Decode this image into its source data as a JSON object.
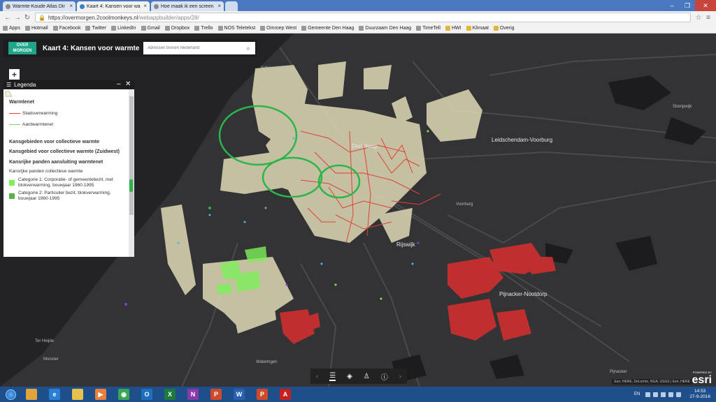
{
  "browser": {
    "tabs": [
      {
        "label": "Warmte-Koude Atlas Dir",
        "active": false
      },
      {
        "label": "Kaart 4: Kansen voor wa",
        "active": true
      },
      {
        "label": "Hoe maak ik een screen",
        "active": false
      }
    ],
    "url_host": "https://overmorgen.2coolmonkeys.nl",
    "url_path": "/webappbuilder/apps/28/",
    "bookmarks": [
      {
        "label": "Apps",
        "icon": "apps-icon"
      },
      {
        "label": "Hotmail",
        "icon": "hotmail-icon"
      },
      {
        "label": "Facebook",
        "icon": "facebook-icon"
      },
      {
        "label": "Twitter",
        "icon": "twitter-icon"
      },
      {
        "label": "LinkedIn",
        "icon": "linkedin-icon"
      },
      {
        "label": "Gmail",
        "icon": "gmail-icon"
      },
      {
        "label": "Dropbox",
        "icon": "dropbox-icon"
      },
      {
        "label": "Trello",
        "icon": "trello-icon"
      },
      {
        "label": "NOS Teletekst",
        "icon": "nos-icon"
      },
      {
        "label": "Omroep West",
        "icon": "omroep-icon"
      },
      {
        "label": "Gemeente Den Haag",
        "icon": "gemeente-icon"
      },
      {
        "label": "Duurzaam Den Haag",
        "icon": "duurzaam-icon"
      },
      {
        "label": "TimeTell",
        "icon": "timetell-icon"
      },
      {
        "label": "HWI",
        "icon": "folder-icon"
      },
      {
        "label": "Klimaat",
        "icon": "folder-icon"
      },
      {
        "label": "Overig",
        "icon": "folder-icon"
      }
    ]
  },
  "app": {
    "logo_line1": "OVER",
    "logo_line2": "MORGEN",
    "title": "Kaart 4: Kansen voor warmte",
    "search_placeholder": "Adressen binnen Nederland",
    "zoom_in": "+"
  },
  "legend": {
    "header": "Legenda",
    "sections": {
      "warmtenet_title": "Warmtenet",
      "stadsverwarming": "Stadsverwarming",
      "aardwarmtenet": "Aardwarmtenet",
      "kansgebieden_title": "Kansgebieden voor collectieve warmte",
      "kansgebied_zw_title": "Kansgebied voor collectieve warmte (Zuidwest)",
      "kansrijke_title": "Kansrijke panden aansluiting warmtenet",
      "kansrijke_sub": "Kansrijke panden collectieve warmte",
      "cat1": "Categorie 1: Corporatie- of gemeentebezit, met blokverwarming, bouwjaar 1960-1995",
      "cat2": "Categorie 2: Particulier bezit, blokverwarming, bouwjaar 1960-1995"
    },
    "colors": {
      "stadsverwarming": "#e0413a",
      "aardwarmtenet": "#7ed957",
      "kansgebied": "#efeacb",
      "cat1": "#7df05a",
      "cat2": "#5bb04a"
    }
  },
  "map_labels": {
    "den_haag": "Den Haag",
    "leidschendam": "Leidschendam-Voorburg",
    "voorburg": "Voorburg",
    "rijswijk": "Rijswijk",
    "pijnacker": "Pijnacker-Nootdorp",
    "stompwijk": "Stompwijk",
    "scheveningen": "Scheveningen",
    "ter_heijde": "Ter Heijde",
    "monster": "Monster",
    "wateringen": "Wateringen",
    "pijnacker_small": "Pijnacker"
  },
  "map_bottom": {
    "attribution": "Esri, HERE, DeLorme, NGA, USGS | Esri, HERE",
    "powered_by": "POWERED BY",
    "esri": "esri"
  },
  "taskbar": {
    "apps": [
      {
        "name": "explorer-app-icon",
        "color": "#e0a43a",
        "glyph": ""
      },
      {
        "name": "ie-app-icon",
        "color": "#2a7fd4",
        "glyph": "e"
      },
      {
        "name": "folder-app-icon",
        "color": "#e8c04c",
        "glyph": ""
      },
      {
        "name": "media-app-icon",
        "color": "#e8803a",
        "glyph": "▶"
      },
      {
        "name": "chrome-app-icon",
        "color": "#3aa655",
        "glyph": "◉"
      },
      {
        "name": "outlook-app-icon",
        "color": "#1f6fc0",
        "glyph": "O"
      },
      {
        "name": "excel-app-icon",
        "color": "#1e7a3c",
        "glyph": "X"
      },
      {
        "name": "onenote-app-icon",
        "color": "#8a3aa8",
        "glyph": "N"
      },
      {
        "name": "powerpoint-app-icon",
        "color": "#d04a2a",
        "glyph": "P"
      },
      {
        "name": "word-app-icon",
        "color": "#2b5fb0",
        "glyph": "W"
      },
      {
        "name": "powerpoint2-app-icon",
        "color": "#d04a2a",
        "glyph": "P"
      },
      {
        "name": "acrobat-app-icon",
        "color": "#c8201e",
        "glyph": "A"
      }
    ],
    "lang": "EN",
    "time": "14:53",
    "date": "27-9-2016"
  }
}
